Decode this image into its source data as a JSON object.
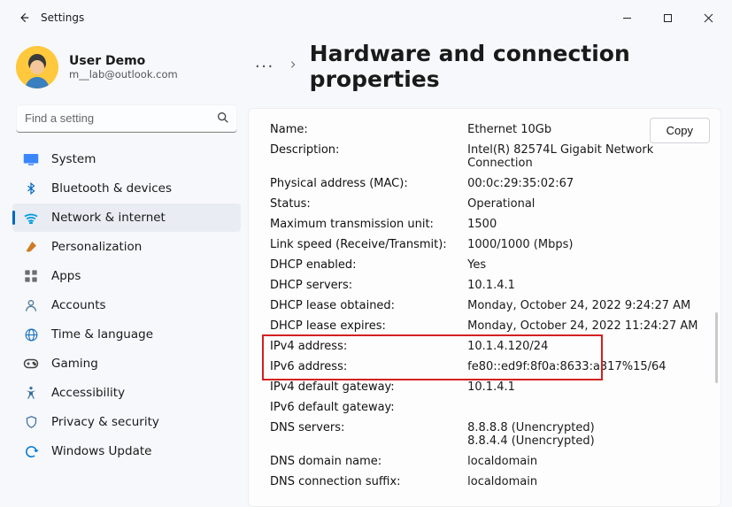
{
  "window": {
    "title": "Settings"
  },
  "user": {
    "name": "User Demo",
    "email": "m__lab@outlook.com"
  },
  "search": {
    "placeholder": "Find a setting"
  },
  "nav": {
    "items": [
      {
        "label": "System",
        "icon": "system"
      },
      {
        "label": "Bluetooth & devices",
        "icon": "bluetooth"
      },
      {
        "label": "Network & internet",
        "icon": "network",
        "selected": true
      },
      {
        "label": "Personalization",
        "icon": "brush"
      },
      {
        "label": "Apps",
        "icon": "apps"
      },
      {
        "label": "Accounts",
        "icon": "accounts"
      },
      {
        "label": "Time & language",
        "icon": "globe"
      },
      {
        "label": "Gaming",
        "icon": "gaming"
      },
      {
        "label": "Accessibility",
        "icon": "accessibility"
      },
      {
        "label": "Privacy & security",
        "icon": "privacy"
      },
      {
        "label": "Windows Update",
        "icon": "update"
      }
    ]
  },
  "breadcrumb": {
    "dots": "···",
    "title": "Hardware and connection properties"
  },
  "copy_label": "Copy",
  "props": [
    {
      "k": "Name:",
      "v": "Ethernet 10Gb"
    },
    {
      "k": "Description:",
      "v": "Intel(R) 82574L Gigabit Network Connection"
    },
    {
      "k": "Physical address (MAC):",
      "v": "00:0c:29:35:02:67"
    },
    {
      "k": "Status:",
      "v": "Operational"
    },
    {
      "k": "Maximum transmission unit:",
      "v": "1500"
    },
    {
      "k": "Link speed (Receive/Transmit):",
      "v": "1000/1000 (Mbps)"
    },
    {
      "k": "DHCP enabled:",
      "v": "Yes"
    },
    {
      "k": "DHCP servers:",
      "v": "10.1.4.1"
    },
    {
      "k": "DHCP lease obtained:",
      "v": "Monday, October 24, 2022 9:24:27 AM"
    },
    {
      "k": "DHCP lease expires:",
      "v": "Monday, October 24, 2022 11:24:27 AM"
    },
    {
      "k": "IPv4 address:",
      "v": "10.1.4.120/24",
      "hl": true
    },
    {
      "k": "IPv6 address:",
      "v": "fe80::ed9f:8f0a:8633:a317%15/64",
      "hl": true
    },
    {
      "k": "IPv4 default gateway:",
      "v": "10.1.4.1"
    },
    {
      "k": "IPv6 default gateway:",
      "v": ""
    },
    {
      "k": "DNS servers:",
      "v": "8.8.8.8 (Unencrypted)\n8.8.4.4 (Unencrypted)"
    },
    {
      "k": "DNS domain name:",
      "v": "localdomain"
    },
    {
      "k": "DNS connection suffix:",
      "v": "localdomain"
    }
  ],
  "icons": {
    "system": "#3a86ff",
    "bluetooth": "#0067c0",
    "network": "#0099e6",
    "brush": "#d17a22",
    "apps": "#6b6d72",
    "accounts": "#4d7a9e",
    "globe": "#1a73c0",
    "gaming": "#444",
    "accessibility": "#3a6ea5",
    "privacy": "#3a6ea5",
    "update": "#0078d4"
  }
}
